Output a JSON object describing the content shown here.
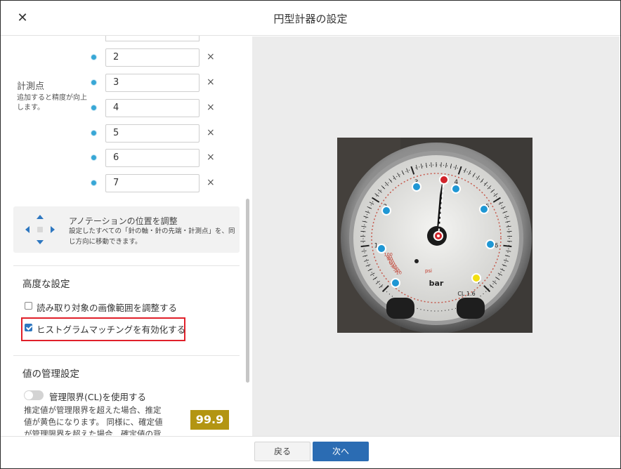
{
  "header": {
    "title": "円型計器の設定",
    "close_icon": "close-icon"
  },
  "measurement_points": {
    "label": "計測点",
    "description": "追加すると精度が向上します。",
    "rows": [
      {
        "value": "2"
      },
      {
        "value": "3"
      },
      {
        "value": "4"
      },
      {
        "value": "5"
      },
      {
        "value": "6"
      },
      {
        "value": "7"
      }
    ],
    "delete_glyph": "×"
  },
  "annotation": {
    "title": "アノテーションの位置を調整",
    "description": "設定したすべての「針の軸・針の先端・計測点」を、同じ方向に移動できます。"
  },
  "advanced": {
    "title": "高度な設定",
    "adjust_range_label": "読み取り対象の画像範囲を調整する",
    "adjust_range_checked": false,
    "histogram_label": "ヒストグラムマッチングを有効化する",
    "histogram_checked": true
  },
  "management": {
    "title": "値の管理設定",
    "cl_toggle_label": "管理限界(CL)を使用する",
    "cl_toggle_on": false,
    "cl_description": "推定値が管理限界を超えた場合、推定値が黄色になります。 同様に、確定値が管理限界を超えた場合、確定値の背",
    "badge_value": "99.9",
    "badge_color": "#b39512"
  },
  "gauge": {
    "unit": "bar",
    "class_label": "CL 1.6",
    "scale_numbers": [
      "0",
      "1",
      "2",
      "3",
      "4",
      "5",
      "6",
      "7"
    ],
    "psi_numbers": [
      "10",
      "20",
      "30",
      "40",
      "50",
      "60",
      "70",
      "80",
      "90",
      "100"
    ],
    "psi_label": "psi"
  },
  "footer": {
    "back_label": "戻る",
    "next_label": "次へ"
  }
}
